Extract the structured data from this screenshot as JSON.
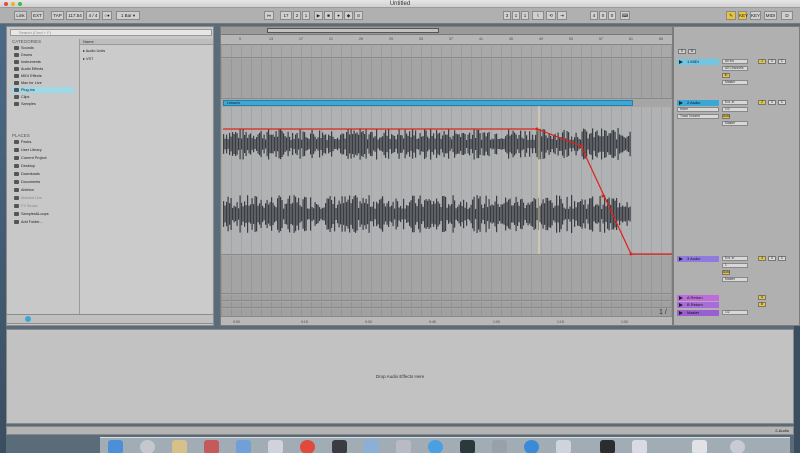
{
  "window": {
    "title": "Untitled"
  },
  "toolbar": {
    "link": "Link",
    "ext": "EXT",
    "tap": "TAP",
    "tempo": "117.54",
    "meter": "4 / 4",
    "metronome": "○●",
    "quantize": "1 Bar",
    "position_bar": "17",
    "position_beat": "2",
    "position_sixteenth": "1",
    "loop_start": "3",
    "loop_start_beat": "1",
    "loop_start_sixteenth": "1",
    "loop_length": "4",
    "loop_length_beat": "0",
    "loop_length_sixteenth": "0",
    "key": "KEY",
    "midi": "MIDI",
    "cpu": "D"
  },
  "browser": {
    "search_placeholder": "Search (Cmd + F)",
    "categories_label": "CATEGORIES",
    "categories": [
      {
        "label": "Sounds",
        "selected": false
      },
      {
        "label": "Drums",
        "selected": false
      },
      {
        "label": "Instruments",
        "selected": false
      },
      {
        "label": "Audio Effects",
        "selected": false
      },
      {
        "label": "MIDI Effects",
        "selected": false
      },
      {
        "label": "Max for Live",
        "selected": false
      },
      {
        "label": "Plug-ins",
        "selected": true
      },
      {
        "label": "Clips",
        "selected": false
      },
      {
        "label": "Samples",
        "selected": false
      }
    ],
    "places_label": "PLACES",
    "places": [
      {
        "label": "Packs",
        "dim": false
      },
      {
        "label": "User Library",
        "dim": false
      },
      {
        "label": "Current Project",
        "dim": false
      },
      {
        "label": "Desktop",
        "dim": false
      },
      {
        "label": "Downloads",
        "dim": false
      },
      {
        "label": "Documents",
        "dim": false
      },
      {
        "label": "Ableton",
        "dim": false
      },
      {
        "label": "Ableton Live",
        "dim": true
      },
      {
        "label": "FX Studio",
        "dim": true
      },
      {
        "label": "Samples&Loops",
        "dim": false
      },
      {
        "label": "Add Folder...",
        "dim": false
      }
    ],
    "name_header": "Name",
    "names": [
      "Audio Units",
      "VST"
    ]
  },
  "arrangement": {
    "clip_name": "Lessons",
    "ruler_ticks": [
      "9",
      "13",
      "17",
      "21",
      "25",
      "29",
      "33",
      "37",
      "41",
      "45",
      "49",
      "53",
      "57",
      "61",
      "65"
    ],
    "timeline_ticks": [
      "0:00",
      "0:15",
      "0:30",
      "0:45",
      "1:00",
      "1:15",
      "1:30",
      "1:45"
    ],
    "page_indicator": "1 / 4"
  },
  "mixer": {
    "tracks": [
      {
        "name": "1 MIDI",
        "color": "#6fc7e6",
        "input": "All Ins",
        "channel": "All Channels",
        "monitor": "In",
        "output": "Master",
        "volume": "0",
        "pan": "C",
        "number": "1"
      },
      {
        "name": "2 Audio",
        "color": "#3aa7d6",
        "input": "Ext. In",
        "channel": "1/2",
        "monitor": "Auto",
        "output": "Master",
        "volume": "0",
        "pan": "C",
        "number": "2",
        "envelope_device": "Mixer",
        "envelope_param": "Track Volume"
      },
      {
        "name": "3 Audio",
        "color": "#8f7be0",
        "input": "Ext. In",
        "channel": "1",
        "monitor": "Auto",
        "output": "Master",
        "volume": "0",
        "pan": "C",
        "number": "3"
      }
    ],
    "returns": [
      {
        "name": "A Return",
        "color": "#c06bdc",
        "letter": "A"
      },
      {
        "name": "B Return",
        "color": "#a86bd8",
        "letter": "B"
      }
    ],
    "master": {
      "name": "Master",
      "color": "#9a5ed0",
      "value": "1/2"
    },
    "header_letters": [
      "S",
      "M"
    ]
  },
  "detail": {
    "drop_text": "Drop Audio Effects Here"
  },
  "status": {
    "right_label": "2-Audio"
  },
  "colors": {
    "accent_blue": "#3aa7d6",
    "envelope_red": "#e0221a",
    "waveform": "#3a3c42",
    "selected_category": "#9ed9e8",
    "yellow_button": "#e8c43a"
  }
}
